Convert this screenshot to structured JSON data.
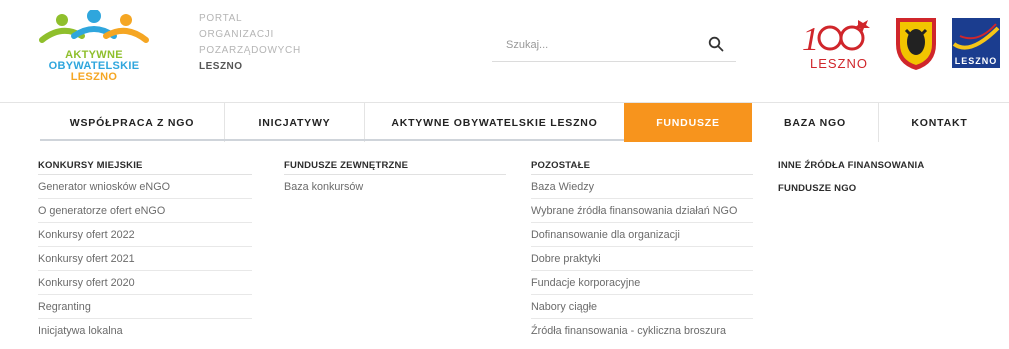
{
  "brand": {
    "logo_lines": [
      "AKTYWNE",
      "OBYWATELSKIE",
      "LESZNO"
    ],
    "portal_lines": [
      "PORTAL",
      "ORGANIZACJI",
      "POZARZĄDOWYCH"
    ],
    "portal_city": "LESZNO",
    "partner_100_text": "LESZNO",
    "partner_logo_text": "LESZNO",
    "colors": {
      "green": "#8fbf2c",
      "blue": "#2fa6dd",
      "orange": "#f5a623",
      "red": "#d0262b",
      "navy": "#1b3d8f"
    }
  },
  "search": {
    "placeholder": "Szukaj...",
    "icon": "search-icon"
  },
  "nav": {
    "items": [
      {
        "label": "WSPÓŁPRACA Z NGO",
        "active": false
      },
      {
        "label": "INICJATYWY",
        "active": false
      },
      {
        "label": "AKTYWNE OBYWATELSKIE LESZNO",
        "active": false
      },
      {
        "label": "FUNDUSZE",
        "active": true
      },
      {
        "label": "BAZA NGO",
        "active": false
      },
      {
        "label": "KONTAKT",
        "active": false
      }
    ],
    "accent": "#f7941d"
  },
  "mega": {
    "columns": [
      {
        "heading": "KONKURSY MIEJSKIE",
        "links": [
          "Generator wniosków eNGO",
          "O generatorze ofert eNGO",
          "Konkursy ofert 2022",
          "Konkursy ofert 2021",
          "Konkursy ofert 2020",
          "Regranting",
          "Inicjatywa lokalna"
        ]
      },
      {
        "heading": "FUNDUSZE ZEWNĘTRZNE",
        "links": [
          "Baza konkursów"
        ]
      },
      {
        "heading": "POZOSTAŁE",
        "links": [
          "Baza Wiedzy",
          "Wybrane źródła finansowania działań NGO",
          "Dofinansowanie dla organizacji",
          "Dobre praktyki",
          "Fundacje korporacyjne",
          "Nabory ciągłe",
          "Źródła finansowania - cykliczna broszura"
        ]
      },
      {
        "heading": "INNE ŹRÓDŁA FINANSOWANIA",
        "links": []
      },
      {
        "heading": "FUNDUSZE NGO",
        "links": []
      }
    ]
  }
}
